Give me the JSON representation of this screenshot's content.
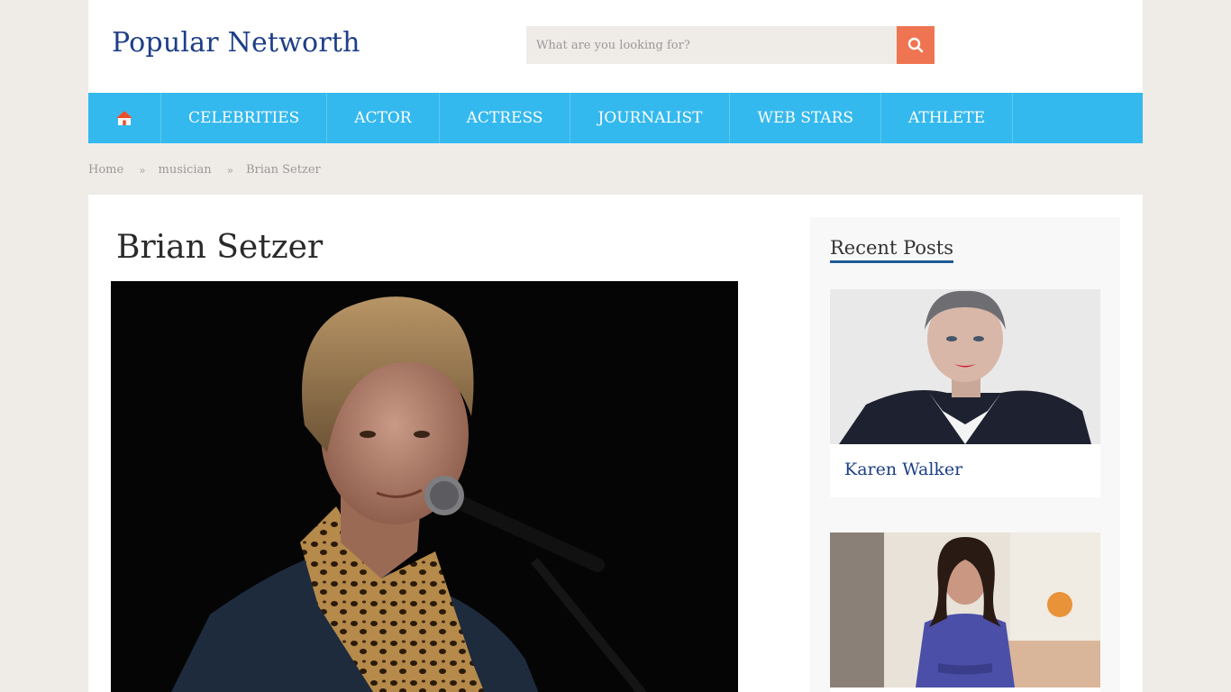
{
  "site": {
    "logo": "Popular Networth"
  },
  "search": {
    "placeholder": "What are you looking for?"
  },
  "nav": {
    "items": [
      {
        "label": "CELEBRITIES"
      },
      {
        "label": "ACTOR"
      },
      {
        "label": "ACTRESS"
      },
      {
        "label": "JOURNALIST"
      },
      {
        "label": "WEB STARS"
      },
      {
        "label": "ATHLETE"
      }
    ]
  },
  "breadcrumb": {
    "home": "Home",
    "category": "musician",
    "current": "Brian Setzer"
  },
  "post": {
    "title": "Brian Setzer"
  },
  "sidebar": {
    "title": "Recent Posts",
    "posts": [
      {
        "title": "Karen Walker"
      },
      {
        "title": ""
      }
    ]
  },
  "colors": {
    "brand": "#1d3f87",
    "nav_bg": "#34b9ee",
    "search_button": "#ef7552",
    "page_bg": "#efebe7"
  },
  "icons": {
    "home": "home-icon",
    "search": "search-icon",
    "breadcrumb_separator": "double-chevron-right-icon"
  }
}
